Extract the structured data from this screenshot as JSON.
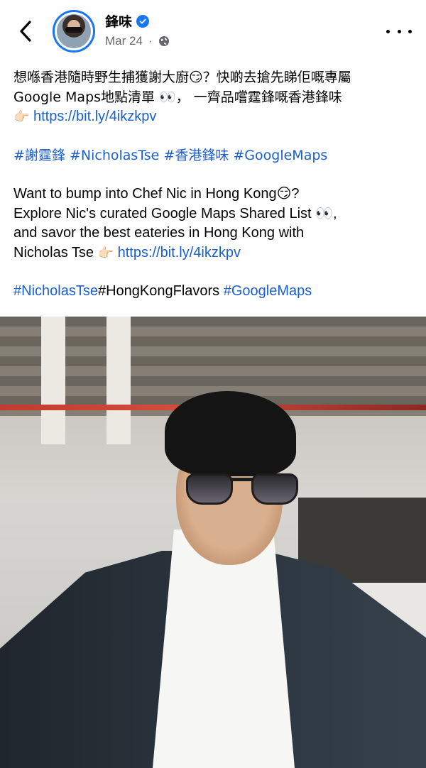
{
  "header": {
    "page_name": "鋒味",
    "date": "Mar 24",
    "verified_icon": "verified-badge-icon",
    "privacy_icon": "globe-icon"
  },
  "post": {
    "zh_line1": "想喺香港隨時野生捕獲謝大廚😏？快啲去搶先睇佢嘅專屬",
    "zh_line2": "Google Maps地點清單 👀，  一齊品嚐霆鋒嘅香港鋒味",
    "zh_pointer": "👉🏻",
    "zh_link": "https://bit.ly/4ikzkpv",
    "zh_tags": [
      "#謝霆鋒",
      "#NicholasTse",
      "#香港鋒味",
      "#GoogleMaps"
    ],
    "en_line1": "Want to bump into Chef Nic in Hong Kong😏?",
    "en_line2": "Explore Nic's curated Google Maps Shared List  👀,",
    "en_line3": "and savor the best eateries in Hong Kong with",
    "en_line4_prefix": "Nicholas Tse",
    "en_pointer": "👉🏻",
    "en_link": "https://bit.ly/4ikzkpv",
    "en_tag1": "#NicholasTse",
    "en_tag_plain": "#HongKongFlavors",
    "en_tag3": "#GoogleMaps"
  },
  "colors": {
    "link": "#1a5fd0",
    "verified": "#1877f2",
    "meta": "#65676b"
  }
}
